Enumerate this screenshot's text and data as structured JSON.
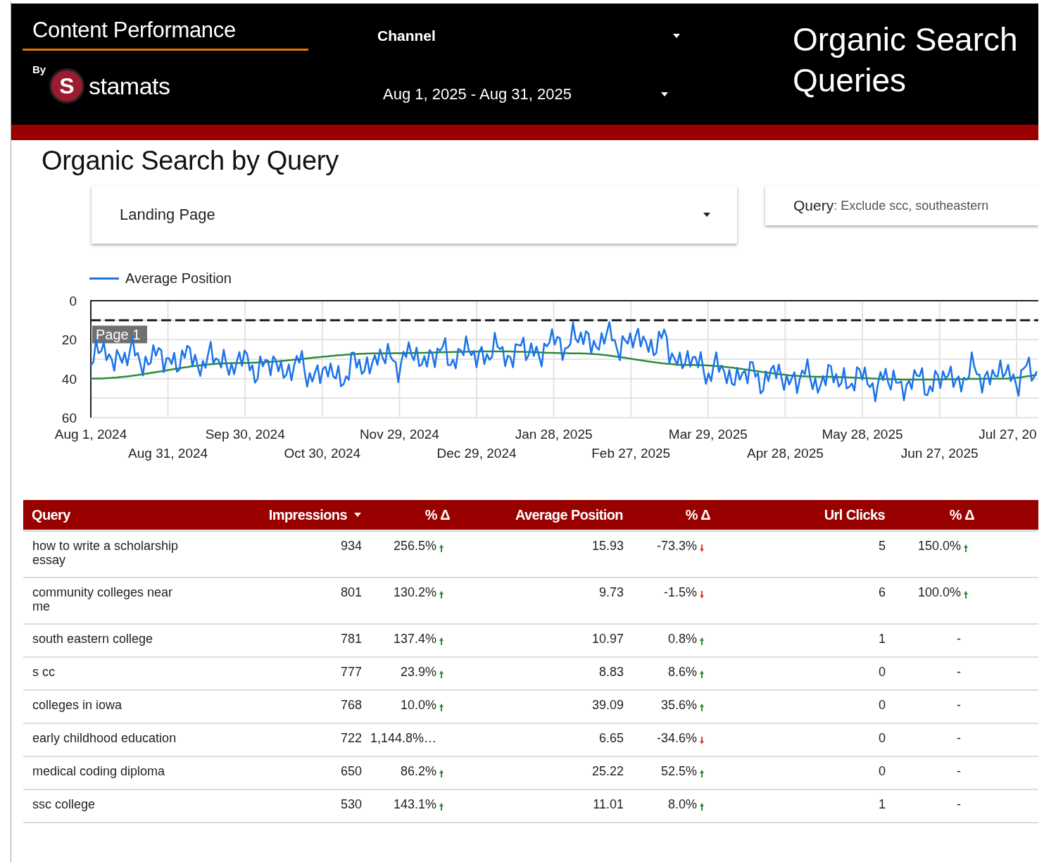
{
  "header": {
    "title": "Content Performance",
    "by_label": "By",
    "logo_mark": "S",
    "logo_text": "stamats",
    "channel_control": {
      "label": "Channel"
    },
    "date_control": {
      "value": "Aug 1, 2025 - Aug 31, 2025"
    },
    "report_title": "Organic Search Queries"
  },
  "section_title": "Organic Search by Query",
  "filters": [
    {
      "kind": "dropdown",
      "label": "Landing Page"
    },
    {
      "kind": "chip",
      "label": "Query",
      "value": ": Exclude scc, southeastern"
    }
  ],
  "chart": {
    "legend": [
      {
        "name": "Average Position",
        "color": "#1a73e8"
      }
    ],
    "band_label": "Page 1",
    "y_labels": [
      "0",
      "20",
      "40",
      "60"
    ],
    "x_labels": [
      "Aug 1, 2024",
      "Aug 31, 2024",
      "Sep 30, 2024",
      "Oct 30, 2024",
      "Nov 29, 2024",
      "Dec 29, 2024",
      "Jan 28, 2025",
      "Feb 27, 2025",
      "Mar 29, 2025",
      "Apr 28, 2025",
      "May 28, 2025",
      "Jun 27, 2025",
      "Jul 27, 20"
    ]
  },
  "table": {
    "columns": [
      {
        "label": "Query",
        "sorted": false
      },
      {
        "label": "Impressions",
        "sorted": true
      },
      {
        "label": "% Δ",
        "sorted": false
      },
      {
        "label": "Average Position",
        "sorted": false
      },
      {
        "label": "% Δ",
        "sorted": false
      },
      {
        "label": "Url Clicks",
        "sorted": false
      },
      {
        "label": "% Δ",
        "sorted": false
      }
    ],
    "rows": [
      {
        "cells": [
          {
            "text": "how to write a scholarship essay"
          },
          {
            "text": "934"
          },
          {
            "text": "256.5%",
            "up": true
          },
          {
            "text": "15.93"
          },
          {
            "text": "-73.3%",
            "up": false
          },
          {
            "text": "5"
          },
          {
            "text": "150.0%",
            "up": true
          }
        ]
      },
      {
        "cells": [
          {
            "text": "community colleges near me"
          },
          {
            "text": "801"
          },
          {
            "text": "130.2%",
            "up": true
          },
          {
            "text": "9.73"
          },
          {
            "text": "-1.5%",
            "up": false
          },
          {
            "text": "6"
          },
          {
            "text": "100.0%",
            "up": true
          }
        ]
      },
      {
        "cells": [
          {
            "text": "south eastern college"
          },
          {
            "text": "781"
          },
          {
            "text": "137.4%",
            "up": true
          },
          {
            "text": "10.97"
          },
          {
            "text": "0.8%",
            "up": true
          },
          {
            "text": "1"
          },
          {
            "text": "-"
          }
        ]
      },
      {
        "cells": [
          {
            "text": "s cc"
          },
          {
            "text": "777"
          },
          {
            "text": "23.9%",
            "up": true
          },
          {
            "text": "8.83"
          },
          {
            "text": "8.6%",
            "up": true
          },
          {
            "text": "0"
          },
          {
            "text": "-"
          }
        ]
      },
      {
        "cells": [
          {
            "text": "colleges in iowa"
          },
          {
            "text": "768"
          },
          {
            "text": "10.0%",
            "up": true
          },
          {
            "text": "39.09"
          },
          {
            "text": "35.6%",
            "up": true
          },
          {
            "text": "0"
          },
          {
            "text": "-"
          }
        ]
      },
      {
        "cells": [
          {
            "text": "early childhood education"
          },
          {
            "text": "722"
          },
          {
            "text": "1,144.8%…"
          },
          {
            "text": "6.65"
          },
          {
            "text": "-34.6%",
            "up": false
          },
          {
            "text": "0"
          },
          {
            "text": "-"
          }
        ]
      },
      {
        "cells": [
          {
            "text": "medical coding diploma"
          },
          {
            "text": "650"
          },
          {
            "text": "86.2%",
            "up": true
          },
          {
            "text": "25.22"
          },
          {
            "text": "52.5%",
            "up": true
          },
          {
            "text": "0"
          },
          {
            "text": "-"
          }
        ]
      },
      {
        "cells": [
          {
            "text": "ssc college"
          },
          {
            "text": "530"
          },
          {
            "text": "143.1%",
            "up": true
          },
          {
            "text": "11.01"
          },
          {
            "text": "8.0%",
            "up": true
          },
          {
            "text": "1"
          },
          {
            "text": "-"
          }
        ]
      }
    ]
  }
}
